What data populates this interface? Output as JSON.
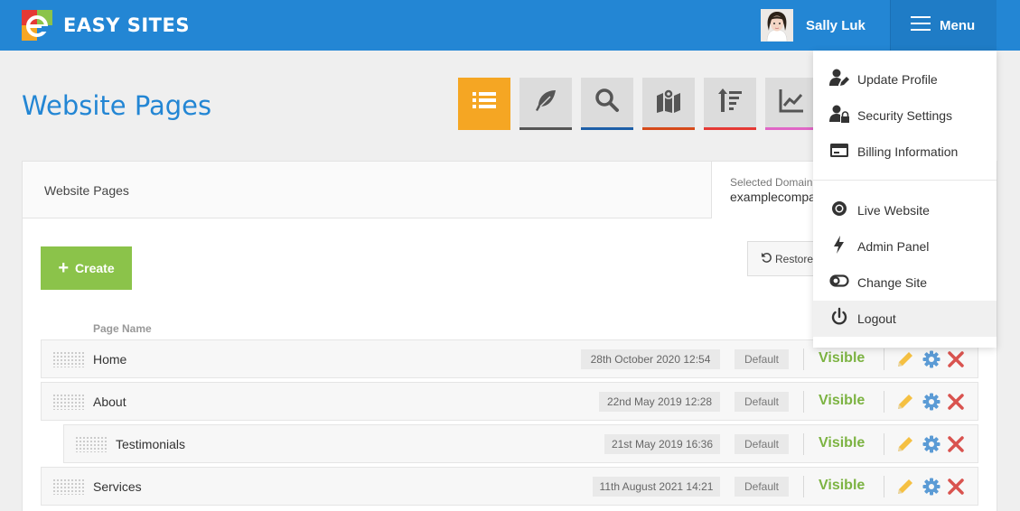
{
  "header": {
    "brand": "EASY SITES",
    "user_name": "Sally Luk",
    "menu_label": "Menu"
  },
  "page": {
    "title": "Website Pages"
  },
  "toolbar": {
    "tools": [
      {
        "icon": "list-icon",
        "underline": "#f5a623",
        "active": true
      },
      {
        "icon": "feather-icon",
        "underline": "#555555"
      },
      {
        "icon": "search-icon",
        "underline": "#1d5fa8"
      },
      {
        "icon": "map-icon",
        "underline": "#d64a1a"
      },
      {
        "icon": "sort-icon",
        "underline": "#e53935"
      },
      {
        "icon": "chart-icon",
        "underline": "#e066c6"
      }
    ]
  },
  "panel": {
    "title": "Website Pages",
    "domain_label": "Selected Domain",
    "domain_value": "examplecompa",
    "create_label": "Create",
    "restore_label": "Restore",
    "column_page_name": "Page Name"
  },
  "rows": [
    {
      "name": "Home",
      "date": "28th October 2020 12:54",
      "template": "Default",
      "status": "Visible",
      "indent": 0
    },
    {
      "name": "About",
      "date": "22nd May 2019 12:28",
      "template": "Default",
      "status": "Visible",
      "indent": 0
    },
    {
      "name": "Testimonials",
      "date": "21st May 2019 16:36",
      "template": "Default",
      "status": "Visible",
      "indent": 1
    },
    {
      "name": "Services",
      "date": "11th August 2021 14:21",
      "template": "Default",
      "status": "Visible",
      "indent": 0
    }
  ],
  "menu": {
    "items": [
      {
        "label": "Update Profile",
        "icon": "user-edit-icon"
      },
      {
        "label": "Security Settings",
        "icon": "user-lock-icon"
      },
      {
        "label": "Billing Information",
        "icon": "credit-card-icon"
      },
      {
        "label": "Live Website",
        "icon": "chrome-icon"
      },
      {
        "label": "Admin Panel",
        "icon": "bolt-icon"
      },
      {
        "label": "Change Site",
        "icon": "toggle-icon"
      },
      {
        "label": "Logout",
        "icon": "power-icon"
      }
    ]
  },
  "colors": {
    "brand_blue": "#2386d4",
    "create_green": "#8bc34a",
    "visible_green": "#7cb342",
    "edit_yellow": "#f5c042",
    "settings_blue": "#5b9bd5",
    "delete_red": "#d9534f"
  }
}
